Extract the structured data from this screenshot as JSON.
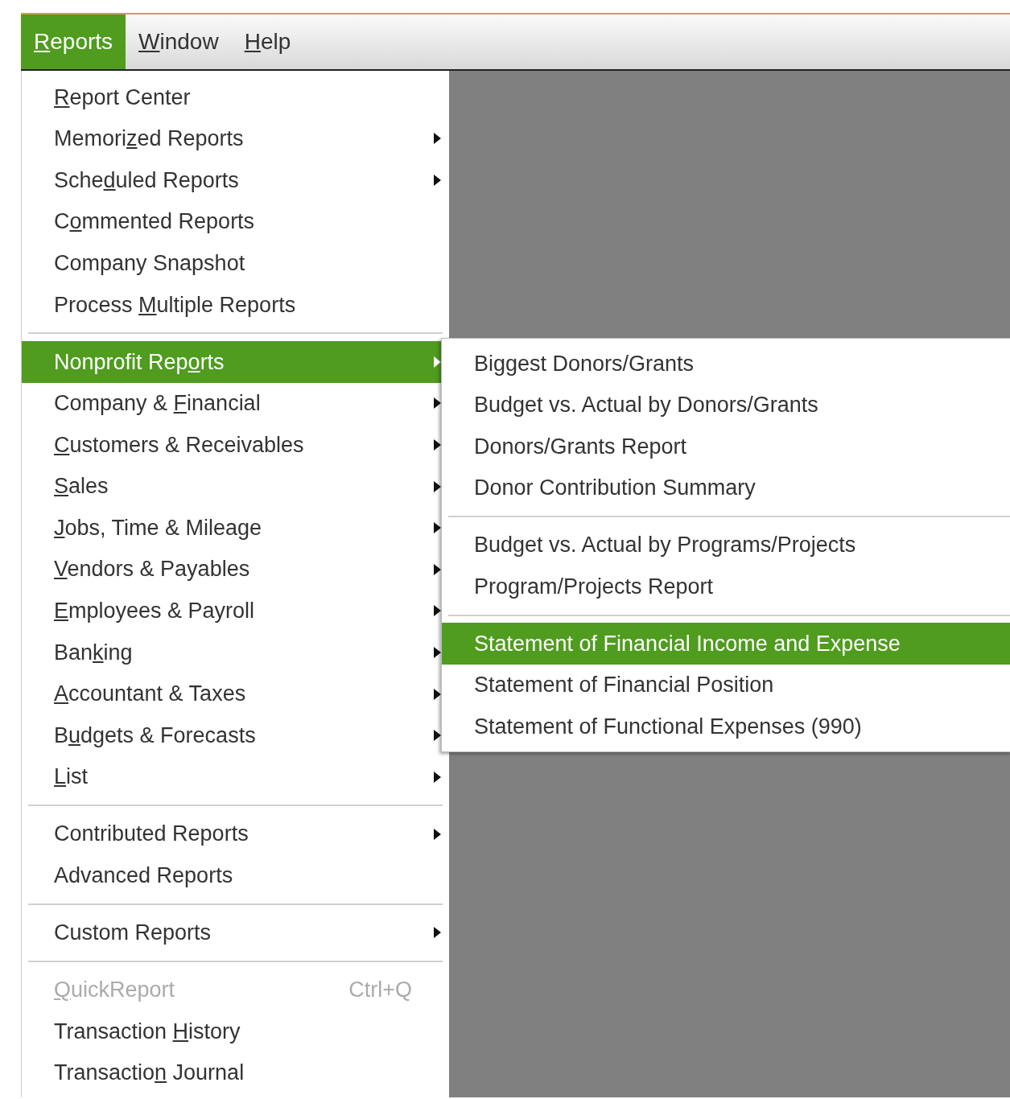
{
  "menubar": [
    {
      "mnemonic": "R",
      "label_after": "eports",
      "selected": true
    },
    {
      "mnemonic": "W",
      "label_after": "indow",
      "selected": false
    },
    {
      "mnemonic": "H",
      "label_after": "elp",
      "selected": false
    }
  ],
  "menu": {
    "items": [
      {
        "kind": "item",
        "mnemonic": "R",
        "label_after": "eport Center",
        "submenu": false,
        "selected": false,
        "disabled": false
      },
      {
        "kind": "item",
        "label_before": "Memori",
        "mnemonic": "z",
        "label_after": "ed Reports",
        "submenu": true,
        "selected": false,
        "disabled": false
      },
      {
        "kind": "item",
        "label_before": "Sche",
        "mnemonic": "d",
        "label_after": "uled Reports",
        "submenu": true,
        "selected": false,
        "disabled": false
      },
      {
        "kind": "item",
        "label_before": "C",
        "mnemonic": "o",
        "label_after": "mmented Reports",
        "submenu": false,
        "selected": false,
        "disabled": false
      },
      {
        "kind": "item",
        "label_before": "Company Snapshot",
        "submenu": false,
        "selected": false,
        "disabled": false
      },
      {
        "kind": "item",
        "label_before": "Process ",
        "mnemonic": "M",
        "label_after": "ultiple Reports",
        "submenu": false,
        "selected": false,
        "disabled": false
      },
      {
        "kind": "separator"
      },
      {
        "kind": "item",
        "label_before": "Nonprofit Rep",
        "mnemonic": "o",
        "label_after": "rts",
        "submenu": true,
        "selected": true,
        "disabled": false
      },
      {
        "kind": "item",
        "label_before": "Company & ",
        "mnemonic": "F",
        "label_after": "inancial",
        "submenu": true,
        "selected": false,
        "disabled": false
      },
      {
        "kind": "item",
        "mnemonic": "C",
        "label_after": "ustomers & Receivables",
        "submenu": true,
        "selected": false,
        "disabled": false
      },
      {
        "kind": "item",
        "mnemonic": "S",
        "label_after": "ales",
        "submenu": true,
        "selected": false,
        "disabled": false
      },
      {
        "kind": "item",
        "mnemonic": "J",
        "label_after": "obs, Time & Mileage",
        "submenu": true,
        "selected": false,
        "disabled": false
      },
      {
        "kind": "item",
        "mnemonic": "V",
        "label_after": "endors & Payables",
        "submenu": true,
        "selected": false,
        "disabled": false
      },
      {
        "kind": "item",
        "mnemonic": "E",
        "label_after": "mployees & Payroll",
        "submenu": true,
        "selected": false,
        "disabled": false
      },
      {
        "kind": "item",
        "label_before": "Ban",
        "mnemonic": "k",
        "label_after": "ing",
        "submenu": true,
        "selected": false,
        "disabled": false
      },
      {
        "kind": "item",
        "mnemonic": "A",
        "label_after": "ccountant & Taxes",
        "submenu": true,
        "selected": false,
        "disabled": false
      },
      {
        "kind": "item",
        "label_before": "B",
        "mnemonic": "u",
        "label_after": "dgets & Forecasts",
        "submenu": true,
        "selected": false,
        "disabled": false
      },
      {
        "kind": "item",
        "mnemonic": "L",
        "label_after": "ist",
        "submenu": true,
        "selected": false,
        "disabled": false
      },
      {
        "kind": "separator"
      },
      {
        "kind": "item",
        "label_before": "Contributed Reports",
        "submenu": true,
        "selected": false,
        "disabled": false
      },
      {
        "kind": "item",
        "label_before": "Advanced Reports",
        "submenu": false,
        "selected": false,
        "disabled": false
      },
      {
        "kind": "separator"
      },
      {
        "kind": "item",
        "label_before": "Custom Reports",
        "submenu": true,
        "selected": false,
        "disabled": false
      },
      {
        "kind": "separator"
      },
      {
        "kind": "item",
        "mnemonic": "Q",
        "label_after": "uickReport",
        "shortcut": "Ctrl+Q",
        "submenu": false,
        "selected": false,
        "disabled": true
      },
      {
        "kind": "item",
        "label_before": "Transaction ",
        "mnemonic": "H",
        "label_after": "istory",
        "submenu": false,
        "selected": false,
        "disabled": false
      },
      {
        "kind": "item",
        "label_before": "Transactio",
        "mnemonic": "n",
        "label_after": " Journal",
        "submenu": false,
        "selected": false,
        "disabled": false
      }
    ]
  },
  "submenu": {
    "items": [
      {
        "kind": "item",
        "label_before": "Biggest Donors/Grants",
        "selected": false
      },
      {
        "kind": "item",
        "label_before": "Budget vs. Actual by Donors/Grants",
        "selected": false
      },
      {
        "kind": "item",
        "label_before": "Donors/Grants Report",
        "selected": false
      },
      {
        "kind": "item",
        "label_before": "Donor Contribution Summary",
        "selected": false
      },
      {
        "kind": "separator"
      },
      {
        "kind": "item",
        "label_before": "Budget vs. Actual by Programs/Projects",
        "selected": false
      },
      {
        "kind": "item",
        "label_before": "Program/Projects Report",
        "selected": false
      },
      {
        "kind": "separator"
      },
      {
        "kind": "item",
        "label_before": "Statement of Financial Income and Expense",
        "selected": true
      },
      {
        "kind": "item",
        "label_before": "Statement of Financial Position",
        "selected": false
      },
      {
        "kind": "item",
        "label_before": "Statement of Functional Expenses (990)",
        "selected": false
      }
    ]
  }
}
